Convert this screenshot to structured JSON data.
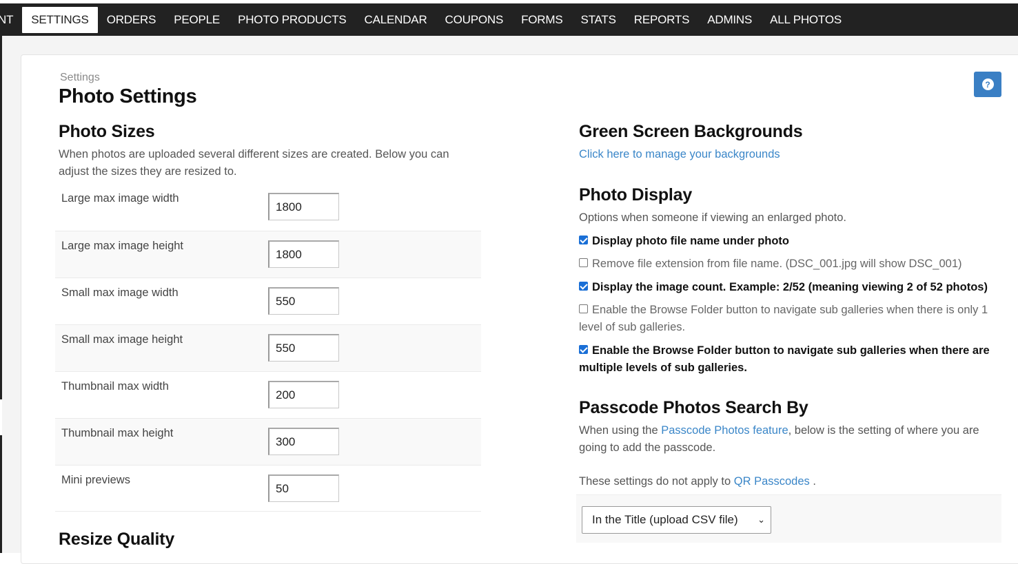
{
  "nav": {
    "items": [
      {
        "label": "NT",
        "active": false
      },
      {
        "label": "SETTINGS",
        "active": true
      },
      {
        "label": "ORDERS",
        "active": false
      },
      {
        "label": "PEOPLE",
        "active": false
      },
      {
        "label": "PHOTO PRODUCTS",
        "active": false
      },
      {
        "label": "CALENDAR",
        "active": false
      },
      {
        "label": "COUPONS",
        "active": false
      },
      {
        "label": "FORMS",
        "active": false
      },
      {
        "label": "STATS",
        "active": false
      },
      {
        "label": "REPORTS",
        "active": false
      },
      {
        "label": "ADMINS",
        "active": false
      },
      {
        "label": "ALL PHOTOS",
        "active": false
      }
    ]
  },
  "header": {
    "breadcrumb": "Settings",
    "title": "Photo Settings",
    "help_icon": "question-circle-icon",
    "help_glyph": "?"
  },
  "photo_sizes": {
    "heading": "Photo Sizes",
    "description": "When photos are uploaded several different sizes are created. Below you can adjust the sizes they are resized to.",
    "fields": [
      {
        "label": "Large max image width",
        "value": "1800"
      },
      {
        "label": "Large max image height",
        "value": "1800"
      },
      {
        "label": "Small max image width",
        "value": "550"
      },
      {
        "label": "Small max image height",
        "value": "550"
      },
      {
        "label": "Thumbnail max width",
        "value": "200"
      },
      {
        "label": "Thumbnail max height",
        "value": "300"
      },
      {
        "label": "Mini previews",
        "value": "50"
      }
    ]
  },
  "resize_quality": {
    "heading": "Resize Quality"
  },
  "green_screen": {
    "heading": "Green Screen Backgrounds",
    "link": "Click here to manage your backgrounds"
  },
  "photo_display": {
    "heading": "Photo Display",
    "description": "Options when someone if viewing an enlarged photo.",
    "options": [
      {
        "label": "Display photo file name under photo",
        "checked": true
      },
      {
        "label": "Remove file extension from file name. (DSC_001.jpg will show DSC_001)",
        "checked": false
      },
      {
        "label": "Display the image count. Example: 2/52 (meaning viewing 2 of 52 photos)",
        "checked": true
      },
      {
        "label": "Enable the Browse Folder button to navigate sub galleries when there is only 1 level of sub galleries.",
        "checked": false
      },
      {
        "label": "Enable the Browse Folder button to navigate sub galleries when there are multiple levels of sub galleries.",
        "checked": true
      }
    ]
  },
  "passcode": {
    "heading": "Passcode Photos Search By",
    "desc_before": "When using the ",
    "desc_link": "Passcode Photos feature",
    "desc_after": ", below is the setting of where you are going to add the passcode.",
    "note_before": "These settings do not apply to ",
    "note_link": "QR Passcodes",
    "note_after": " .",
    "select_value": "In the Title (upload CSV file)",
    "select_icon": "chevron-down-icon"
  },
  "colors": {
    "nav_bg": "#222222",
    "accent": "#3a7fc4",
    "link": "#3a86c8",
    "checkbox": "#1a6fd6"
  }
}
